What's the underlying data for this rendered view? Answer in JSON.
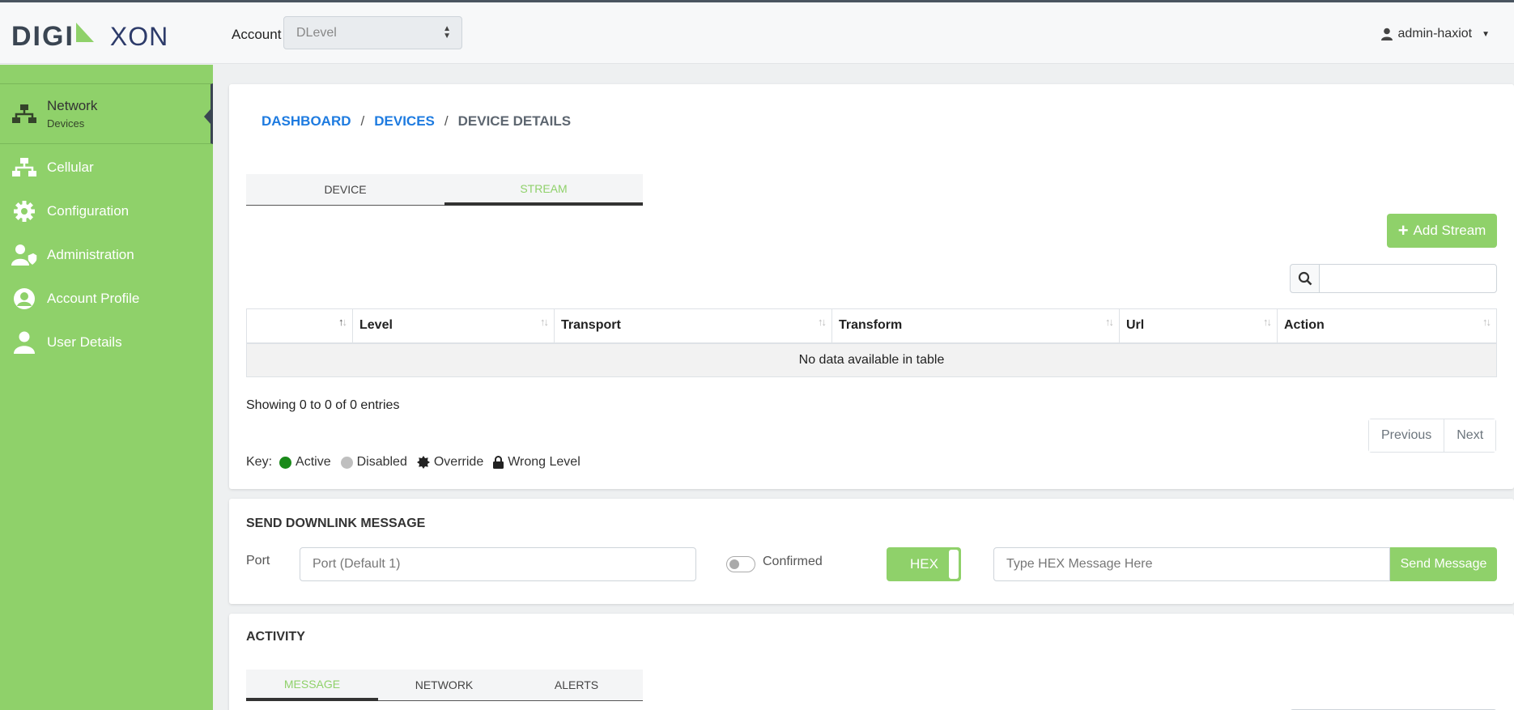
{
  "brand": {
    "logo_left": "DIGI",
    "logo_right": "XON",
    "accent": "#8fd16a"
  },
  "header": {
    "account_label": "Account",
    "account_value": "DLevel",
    "user": "admin-haxiot"
  },
  "sidebar": {
    "items": [
      {
        "label": "Network",
        "sublabel": "Devices",
        "icon": "network-icon"
      },
      {
        "label": "Cellular",
        "icon": "network-icon"
      },
      {
        "label": "Configuration",
        "icon": "gear-icon"
      },
      {
        "label": "Administration",
        "icon": "user-shield-icon"
      },
      {
        "label": "Account Profile",
        "icon": "user-circle-icon"
      },
      {
        "label": "User Details",
        "icon": "user-icon"
      }
    ]
  },
  "breadcrumb": {
    "dashboard": "DASHBOARD",
    "devices": "DEVICES",
    "current": "DEVICE DETAILS",
    "sep": "/"
  },
  "device_tabs": [
    {
      "label": "DEVICE"
    },
    {
      "label": "STREAM"
    }
  ],
  "stream": {
    "add_label": "Add Stream",
    "columns": [
      "",
      "Level",
      "Transport",
      "Transform",
      "Url",
      "Action"
    ],
    "empty_text": "No data available in table",
    "info": "Showing 0 to 0 of 0 entries",
    "pager": {
      "prev": "Previous",
      "next": "Next"
    },
    "key": {
      "label": "Key:",
      "active": "Active",
      "disabled": "Disabled",
      "override": "Override",
      "wrong_level": "Wrong Level",
      "active_color": "#1a8a1a",
      "disabled_color": "#bfbfbf"
    }
  },
  "downlink": {
    "title": "SEND DOWNLINK MESSAGE",
    "port_label": "Port",
    "port_placeholder": "Port (Default 1)",
    "confirmed_label": "Confirmed",
    "hex_label": "HEX",
    "message_placeholder": "Type HEX Message Here",
    "send_label": "Send Message"
  },
  "activity": {
    "title": "ACTIVITY",
    "tabs": [
      {
        "label": "MESSAGE"
      },
      {
        "label": "NETWORK"
      },
      {
        "label": "ALERTS"
      }
    ]
  }
}
